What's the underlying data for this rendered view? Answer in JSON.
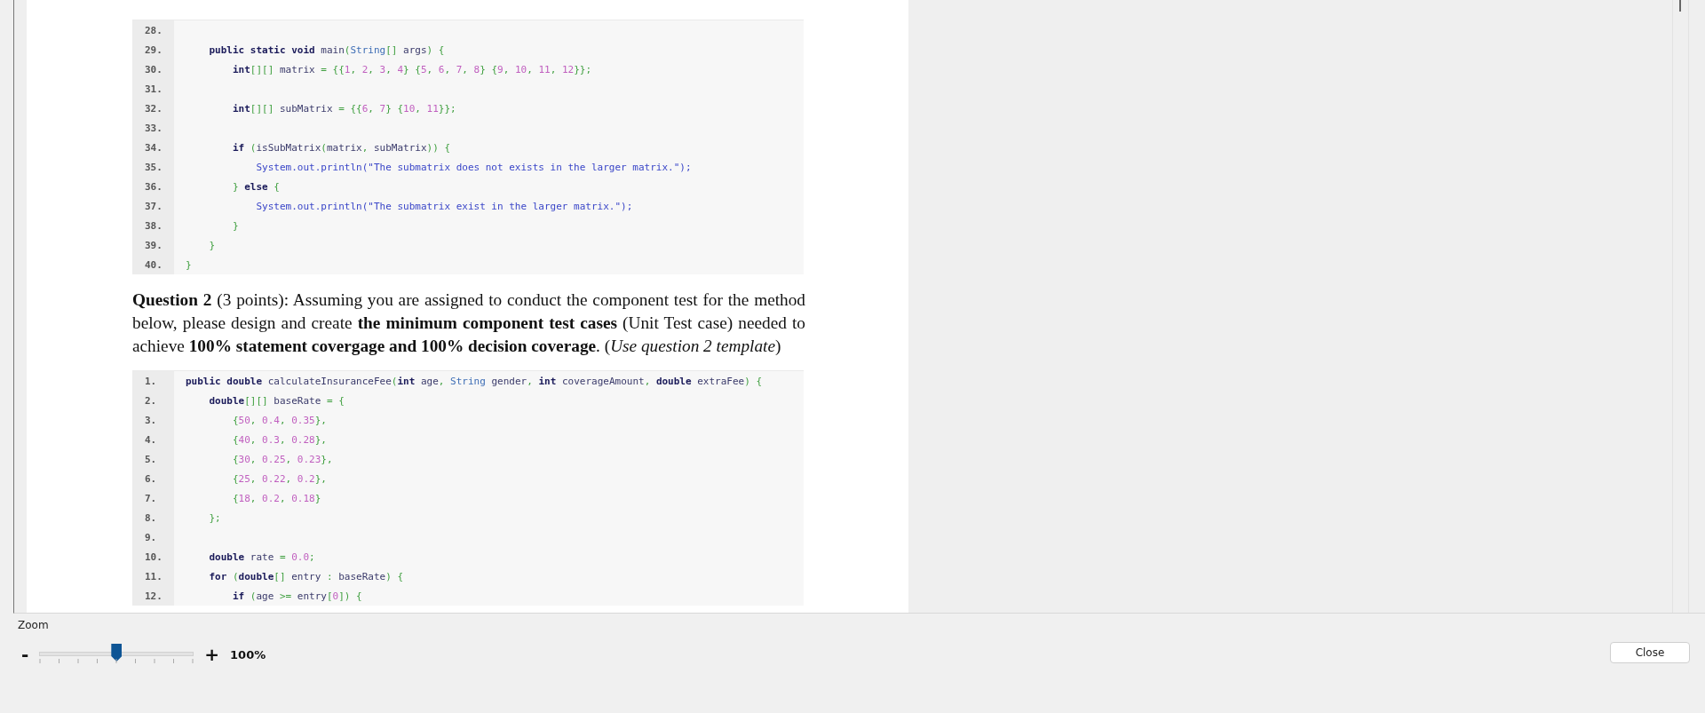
{
  "document": {
    "content": [
      {
        "kind": "code",
        "lines": [
          {
            "number": "28."
          },
          {
            "number": "29.",
            "tokens": [
              {
                "kind": "k",
                "text": "    public static void "
              },
              {
                "kind": "p",
                "text": "main"
              },
              {
                "kind": "u",
                "text": "("
              },
              {
                "kind": "t",
                "text": "String"
              },
              {
                "kind": "u",
                "text": "[] "
              },
              {
                "kind": "p",
                "text": "args"
              },
              {
                "kind": "u",
                "text": ") {"
              }
            ]
          },
          {
            "number": "30.",
            "tokens": [
              {
                "kind": "k",
                "text": "        int"
              },
              {
                "kind": "u",
                "text": "[][] "
              },
              {
                "kind": "p",
                "text": "matrix "
              },
              {
                "kind": "u",
                "text": "= {{"
              },
              {
                "kind": "n",
                "text": "1"
              },
              {
                "kind": "u",
                "text": ", "
              },
              {
                "kind": "n",
                "text": "2"
              },
              {
                "kind": "u",
                "text": ", "
              },
              {
                "kind": "n",
                "text": "3"
              },
              {
                "kind": "u",
                "text": ", "
              },
              {
                "kind": "n",
                "text": "4"
              },
              {
                "kind": "u",
                "text": "} {"
              },
              {
                "kind": "n",
                "text": "5"
              },
              {
                "kind": "u",
                "text": ", "
              },
              {
                "kind": "n",
                "text": "6"
              },
              {
                "kind": "u",
                "text": ", "
              },
              {
                "kind": "n",
                "text": "7"
              },
              {
                "kind": "u",
                "text": ", "
              },
              {
                "kind": "n",
                "text": "8"
              },
              {
                "kind": "u",
                "text": "} {"
              },
              {
                "kind": "n",
                "text": "9"
              },
              {
                "kind": "u",
                "text": ", "
              },
              {
                "kind": "n",
                "text": "10"
              },
              {
                "kind": "u",
                "text": ", "
              },
              {
                "kind": "n",
                "text": "11"
              },
              {
                "kind": "u",
                "text": ", "
              },
              {
                "kind": "n",
                "text": "12"
              },
              {
                "kind": "u",
                "text": "}};"
              }
            ]
          },
          {
            "number": "31."
          },
          {
            "number": "32.",
            "tokens": [
              {
                "kind": "k",
                "text": "        int"
              },
              {
                "kind": "u",
                "text": "[][] "
              },
              {
                "kind": "p",
                "text": "subMatrix "
              },
              {
                "kind": "u",
                "text": "= {{"
              },
              {
                "kind": "n",
                "text": "6"
              },
              {
                "kind": "u",
                "text": ", "
              },
              {
                "kind": "n",
                "text": "7"
              },
              {
                "kind": "u",
                "text": "} {"
              },
              {
                "kind": "n",
                "text": "10"
              },
              {
                "kind": "u",
                "text": ", "
              },
              {
                "kind": "n",
                "text": "11"
              },
              {
                "kind": "u",
                "text": "}};"
              }
            ]
          },
          {
            "number": "33."
          },
          {
            "number": "34.",
            "tokens": [
              {
                "kind": "k",
                "text": "        if "
              },
              {
                "kind": "u",
                "text": "("
              },
              {
                "kind": "p",
                "text": "isSubMatrix"
              },
              {
                "kind": "u",
                "text": "("
              },
              {
                "kind": "p",
                "text": "matrix"
              },
              {
                "kind": "u",
                "text": ", "
              },
              {
                "kind": "p",
                "text": "subMatrix"
              },
              {
                "kind": "u",
                "text": ")) {"
              }
            ]
          },
          {
            "number": "35.",
            "tokens": [
              {
                "kind": "s",
                "text": "            System.out.println(\"The submatrix does not exists in the larger matrix.\");"
              }
            ]
          },
          {
            "number": "36.",
            "tokens": [
              {
                "kind": "u",
                "text": "        } "
              },
              {
                "kind": "k",
                "text": "else "
              },
              {
                "kind": "u",
                "text": "{"
              }
            ]
          },
          {
            "number": "37.",
            "tokens": [
              {
                "kind": "s",
                "text": "            System.out.println(\"The submatrix exist in the larger matrix.\");"
              }
            ]
          },
          {
            "number": "38.",
            "tokens": [
              {
                "kind": "u",
                "text": "        }"
              }
            ]
          },
          {
            "number": "39.",
            "tokens": [
              {
                "kind": "u",
                "text": "    }"
              }
            ]
          },
          {
            "number": "40.",
            "tokens": [
              {
                "kind": "u",
                "text": "}"
              }
            ]
          }
        ]
      },
      {
        "kind": "question",
        "text": "**Question 2** (3 points): Assuming you are assigned to conduct the component test for the method below, please design and create **the minimum component test cases** (Unit Test case) needed to achieve **100% statement covergage and 100% decision coverage**. (*Use question 2 template*)"
      },
      {
        "kind": "code",
        "lines": [
          {
            "number": "1.",
            "tokens": [
              {
                "kind": "k",
                "text": "public double "
              },
              {
                "kind": "p",
                "text": "calculateInsuranceFee"
              },
              {
                "kind": "u",
                "text": "("
              },
              {
                "kind": "k",
                "text": "int "
              },
              {
                "kind": "p",
                "text": "age"
              },
              {
                "kind": "u",
                "text": ", "
              },
              {
                "kind": "t",
                "text": "String "
              },
              {
                "kind": "p",
                "text": "gender"
              },
              {
                "kind": "u",
                "text": ", "
              },
              {
                "kind": "k",
                "text": "int "
              },
              {
                "kind": "p",
                "text": "coverageAmount"
              },
              {
                "kind": "u",
                "text": ", "
              },
              {
                "kind": "k",
                "text": "double "
              },
              {
                "kind": "p",
                "text": "extraFee"
              },
              {
                "kind": "u",
                "text": ") {"
              }
            ]
          },
          {
            "number": "2.",
            "tokens": [
              {
                "kind": "k",
                "text": "    double"
              },
              {
                "kind": "u",
                "text": "[][] "
              },
              {
                "kind": "p",
                "text": "baseRate "
              },
              {
                "kind": "u",
                "text": "= {"
              }
            ]
          },
          {
            "number": "3.",
            "tokens": [
              {
                "kind": "u",
                "text": "        {"
              },
              {
                "kind": "n",
                "text": "50"
              },
              {
                "kind": "u",
                "text": ", "
              },
              {
                "kind": "n",
                "text": "0.4"
              },
              {
                "kind": "u",
                "text": ", "
              },
              {
                "kind": "n",
                "text": "0.35"
              },
              {
                "kind": "u",
                "text": "},"
              }
            ]
          },
          {
            "number": "4.",
            "tokens": [
              {
                "kind": "u",
                "text": "        {"
              },
              {
                "kind": "n",
                "text": "40"
              },
              {
                "kind": "u",
                "text": ", "
              },
              {
                "kind": "n",
                "text": "0.3"
              },
              {
                "kind": "u",
                "text": ", "
              },
              {
                "kind": "n",
                "text": "0.28"
              },
              {
                "kind": "u",
                "text": "},"
              }
            ]
          },
          {
            "number": "5.",
            "tokens": [
              {
                "kind": "u",
                "text": "        {"
              },
              {
                "kind": "n",
                "text": "30"
              },
              {
                "kind": "u",
                "text": ", "
              },
              {
                "kind": "n",
                "text": "0.25"
              },
              {
                "kind": "u",
                "text": ", "
              },
              {
                "kind": "n",
                "text": "0.23"
              },
              {
                "kind": "u",
                "text": "},"
              }
            ]
          },
          {
            "number": "6.",
            "tokens": [
              {
                "kind": "u",
                "text": "        {"
              },
              {
                "kind": "n",
                "text": "25"
              },
              {
                "kind": "u",
                "text": ", "
              },
              {
                "kind": "n",
                "text": "0.22"
              },
              {
                "kind": "u",
                "text": ", "
              },
              {
                "kind": "n",
                "text": "0.2"
              },
              {
                "kind": "u",
                "text": "},"
              }
            ]
          },
          {
            "number": "7.",
            "tokens": [
              {
                "kind": "u",
                "text": "        {"
              },
              {
                "kind": "n",
                "text": "18"
              },
              {
                "kind": "u",
                "text": ", "
              },
              {
                "kind": "n",
                "text": "0.2"
              },
              {
                "kind": "u",
                "text": ", "
              },
              {
                "kind": "n",
                "text": "0.18"
              },
              {
                "kind": "u",
                "text": "}"
              }
            ]
          },
          {
            "number": "8.",
            "tokens": [
              {
                "kind": "u",
                "text": "    };"
              }
            ]
          },
          {
            "number": "9."
          },
          {
            "number": "10.",
            "tokens": [
              {
                "kind": "k",
                "text": "    double "
              },
              {
                "kind": "p",
                "text": "rate "
              },
              {
                "kind": "u",
                "text": "= "
              },
              {
                "kind": "n",
                "text": "0.0"
              },
              {
                "kind": "u",
                "text": ";"
              }
            ]
          },
          {
            "number": "11.",
            "tokens": [
              {
                "kind": "k",
                "text": "    for "
              },
              {
                "kind": "u",
                "text": "("
              },
              {
                "kind": "k",
                "text": "double"
              },
              {
                "kind": "u",
                "text": "[] "
              },
              {
                "kind": "p",
                "text": "entry "
              },
              {
                "kind": "u",
                "text": ": "
              },
              {
                "kind": "p",
                "text": "baseRate"
              },
              {
                "kind": "u",
                "text": ") {"
              }
            ]
          },
          {
            "number": "12.",
            "tokens": [
              {
                "kind": "k",
                "text": "        if "
              },
              {
                "kind": "u",
                "text": "("
              },
              {
                "kind": "p",
                "text": "age "
              },
              {
                "kind": "u",
                "text": ">= "
              },
              {
                "kind": "p",
                "text": "entry"
              },
              {
                "kind": "u",
                "text": "["
              },
              {
                "kind": "n",
                "text": "0"
              },
              {
                "kind": "u",
                "text": "]) {"
              }
            ]
          }
        ]
      }
    ]
  },
  "zoom": {
    "label": "Zoom",
    "minus": "-",
    "plus": "+",
    "level": 0.5,
    "value": "100%"
  },
  "close_button": "Close"
}
